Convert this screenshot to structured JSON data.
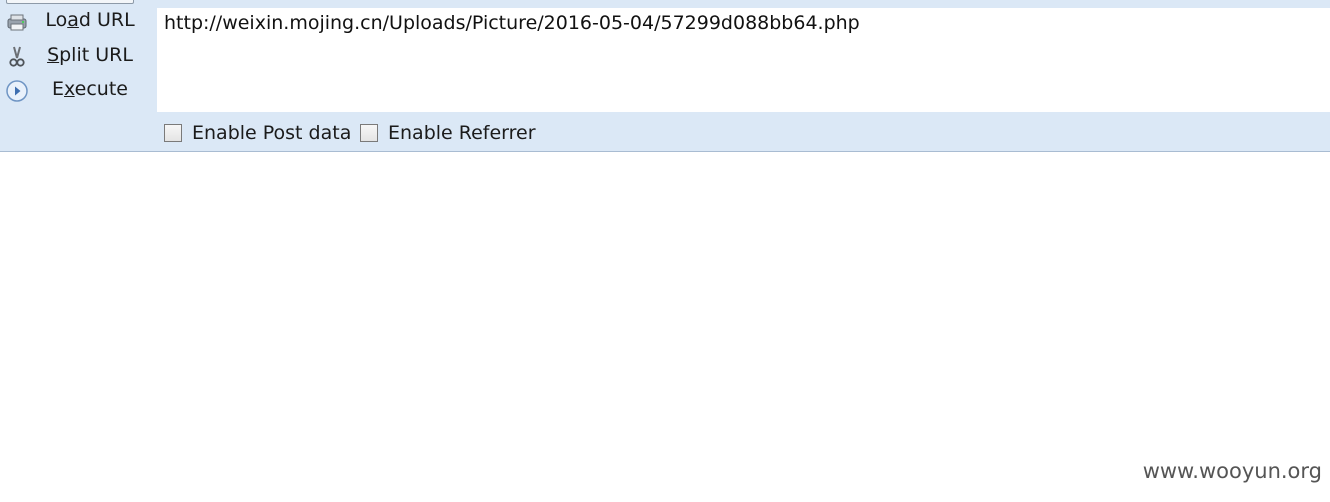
{
  "commands": {
    "load_url": {
      "pre": "Lo",
      "acc": "a",
      "post": "d URL",
      "icon": "load-url-icon"
    },
    "split_url": {
      "pre": "",
      "acc": "S",
      "post": "plit URL",
      "icon": "scissors-icon"
    },
    "execute": {
      "pre": "E",
      "acc": "x",
      "post": "ecute",
      "icon": "play-icon"
    }
  },
  "url_field": {
    "value": "http://weixin.mojing.cn/Uploads/Picture/2016-05-04/57299d088bb64.php"
  },
  "options": {
    "post_data": {
      "label": "Enable Post data",
      "checked": false
    },
    "referrer": {
      "label": "Enable Referrer",
      "checked": false
    }
  },
  "watermark": "www.wooyun.org",
  "colors": {
    "panel_bg": "#dbe8f6",
    "panel_border": "#a9bcd2",
    "text": "#1b1b1b",
    "watermark": "#555555"
  }
}
